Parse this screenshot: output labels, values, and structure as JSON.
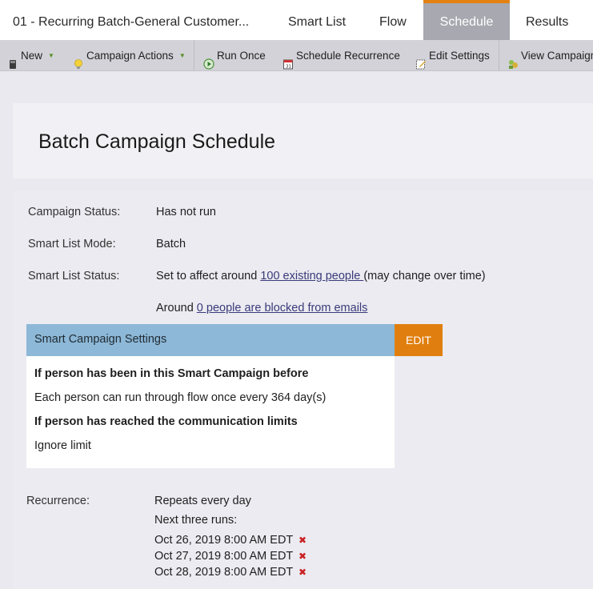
{
  "tabs": {
    "title": "01 - Recurring Batch-General Customer...",
    "smart_list": "Smart List",
    "flow": "Flow",
    "schedule": "Schedule",
    "results": "Results",
    "active": "Schedule"
  },
  "toolbar": {
    "new": "New",
    "campaign_actions": "Campaign Actions",
    "run_once": "Run Once",
    "schedule_recurrence": "Schedule Recurrence",
    "edit_settings": "Edit Settings",
    "view_campaign": "View Campaign"
  },
  "page_title": "Batch Campaign Schedule",
  "status": {
    "campaign_status_label": "Campaign Status:",
    "campaign_status_value": "Has not run",
    "smart_list_mode_label": "Smart List Mode:",
    "smart_list_mode_value": "Batch",
    "smart_list_status_label": "Smart List Status:",
    "smart_list_status_prefix": "Set to affect around",
    "smart_list_status_link": "100 existing people ",
    "smart_list_status_suffix": "(may change over time)",
    "blocked_prefix": "Around",
    "blocked_link": "0 people are blocked from emails"
  },
  "settings": {
    "header": "Smart Campaign Settings",
    "edit_label": "EDIT",
    "line1_heading": "If person has been in this Smart Campaign before",
    "line1_value": "Each person can run through flow once every 364 day(s)",
    "line2_heading": "If person has reached the communication limits",
    "line2_value": "Ignore limit"
  },
  "recurrence": {
    "label": "Recurrence:",
    "value": "Repeats every day",
    "next_runs_label": "Next three runs:",
    "runs": [
      "Oct 26, 2019 8:00 AM EDT",
      "Oct 27, 2019 8:00 AM EDT",
      "Oct 28, 2019 8:00 AM EDT"
    ],
    "delete_glyph": "✖"
  },
  "colors": {
    "active_tab_bg": "#a8a8b0",
    "active_tab_accent": "#e38212",
    "settings_header": "#8db8d7",
    "edit_button": "#e07f0f",
    "delete_x": "#c92222"
  }
}
